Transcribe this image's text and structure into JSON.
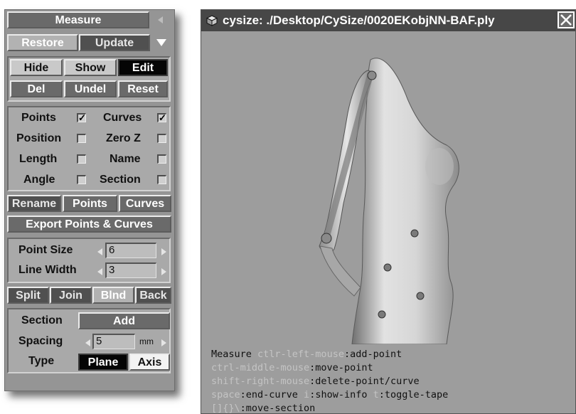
{
  "panel": {
    "title": "Measure",
    "restore": "Restore",
    "update": "Update",
    "hide": "Hide",
    "show": "Show",
    "edit": "Edit",
    "del": "Del",
    "undel": "Undel",
    "reset": "Reset",
    "toggles": [
      {
        "label": "Points",
        "checked": true
      },
      {
        "label": "Curves",
        "checked": true
      },
      {
        "label": "Position",
        "checked": false
      },
      {
        "label": "Zero Z",
        "checked": false
      },
      {
        "label": "Length",
        "checked": false
      },
      {
        "label": "Name",
        "checked": false
      },
      {
        "label": "Angle",
        "checked": false
      },
      {
        "label": "Section",
        "checked": false
      }
    ],
    "rename": "Rename",
    "rename_points": "Points",
    "rename_curves": "Curves",
    "export": "Export Points & Curves",
    "point_size_label": "Point Size",
    "point_size_value": "6",
    "line_width_label": "Line Width",
    "line_width_value": "3",
    "split": "Split",
    "join": "Join",
    "blnd": "Blnd",
    "back": "Back",
    "section_label": "Section",
    "add": "Add",
    "spacing_label": "Spacing",
    "spacing_value": "5",
    "spacing_unit": "mm",
    "type_label": "Type",
    "plane": "Plane",
    "axis": "Axis"
  },
  "window": {
    "title": "cysize: ./Desktop/CySize/0020EKobjNN-BAF.ply",
    "help": [
      [
        {
          "t": "Measure ",
          "dim": false
        },
        {
          "t": "ctlr-left-mouse",
          "dim": true
        },
        {
          "t": ":add-point",
          "dim": false
        }
      ],
      [
        {
          "t": "ctrl-middle-mouse",
          "dim": true
        },
        {
          "t": ":move-point",
          "dim": false
        }
      ],
      [
        {
          "t": "shift-right-mouse",
          "dim": true
        },
        {
          "t": ":delete-point/curve",
          "dim": false
        }
      ],
      [
        {
          "t": "space",
          "dim": true
        },
        {
          "t": ":end-curve ",
          "dim": false
        },
        {
          "t": "i",
          "dim": true
        },
        {
          "t": ":show-info ",
          "dim": false
        },
        {
          "t": "t",
          "dim": true
        },
        {
          "t": ":toggle-tape",
          "dim": false
        }
      ],
      [
        {
          "t": "[]{}\\",
          "dim": true
        },
        {
          "t": ":move-section",
          "dim": false
        }
      ]
    ]
  },
  "icons": [
    "collapse-left-icon",
    "menu-down-icon",
    "decrement-icon",
    "increment-icon",
    "cube-icon",
    "close-icon"
  ]
}
